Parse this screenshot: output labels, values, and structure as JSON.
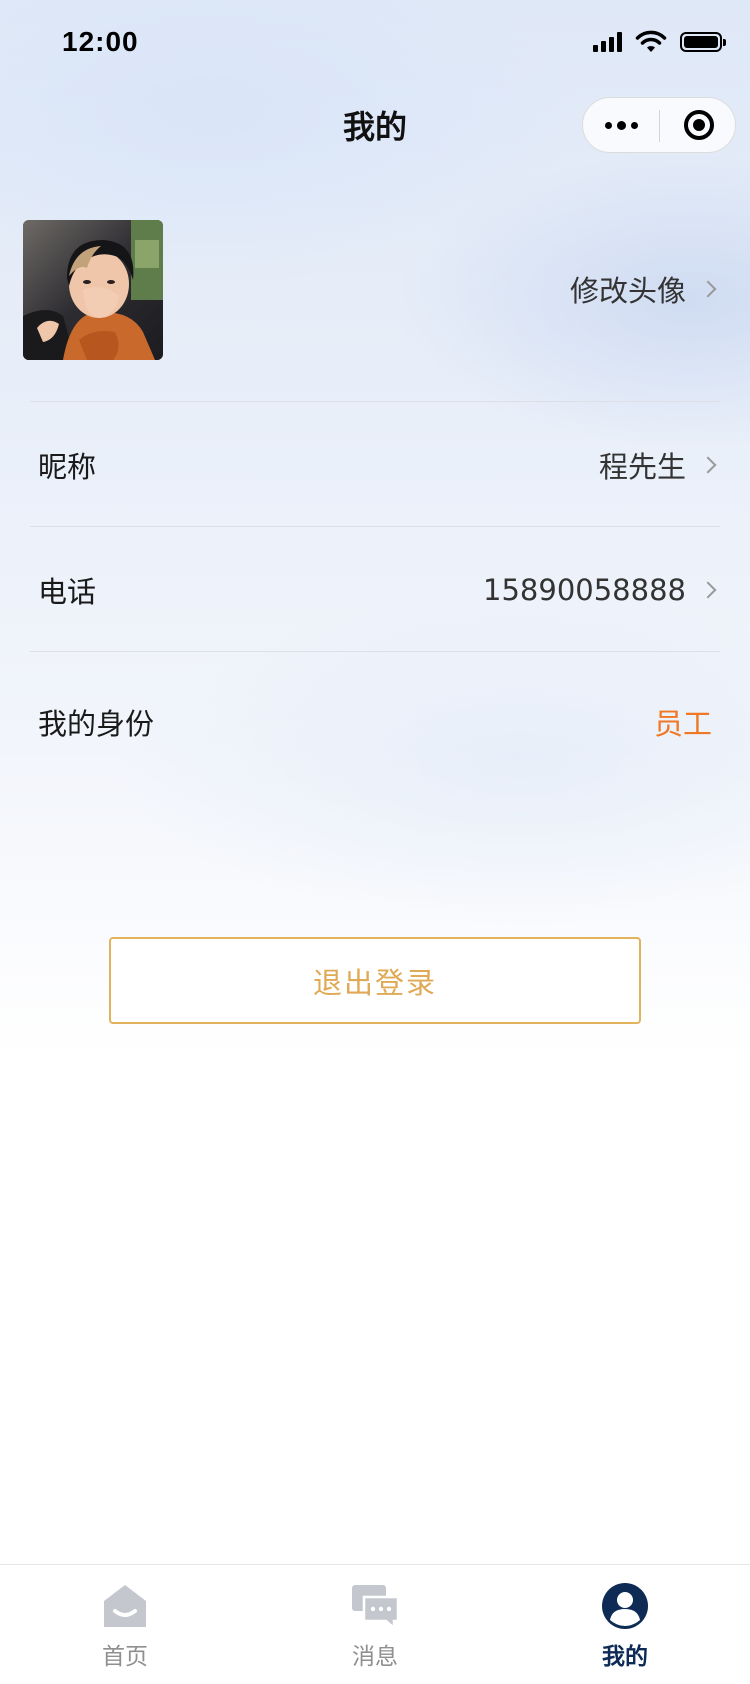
{
  "status_bar": {
    "time": "12:00",
    "icons": [
      "signal-icon",
      "wifi-icon",
      "battery-icon"
    ]
  },
  "header": {
    "title": "我的",
    "capsule": {
      "more_icon": "more-dots-icon",
      "close_icon": "target-close-icon"
    }
  },
  "profile": {
    "avatar_action": "修改头像",
    "rows": [
      {
        "label": "昵称",
        "value": "程先生",
        "has_arrow": true
      },
      {
        "label": "电话",
        "value": "15890058888",
        "has_arrow": true
      },
      {
        "label": "我的身份",
        "value": "员工",
        "has_arrow": false
      }
    ]
  },
  "logout": {
    "label": "退出登录"
  },
  "tab_bar": {
    "items": [
      {
        "label": "首页",
        "icon": "home-icon",
        "active": false
      },
      {
        "label": "消息",
        "icon": "message-icon",
        "active": false
      },
      {
        "label": "我的",
        "icon": "user-icon",
        "active": true
      }
    ]
  },
  "colors": {
    "accent_orange": "#f07824",
    "logout_gold": "#e2b35c",
    "active_tab": "#0d2b55",
    "inactive_tab": "#8f8f8f"
  }
}
